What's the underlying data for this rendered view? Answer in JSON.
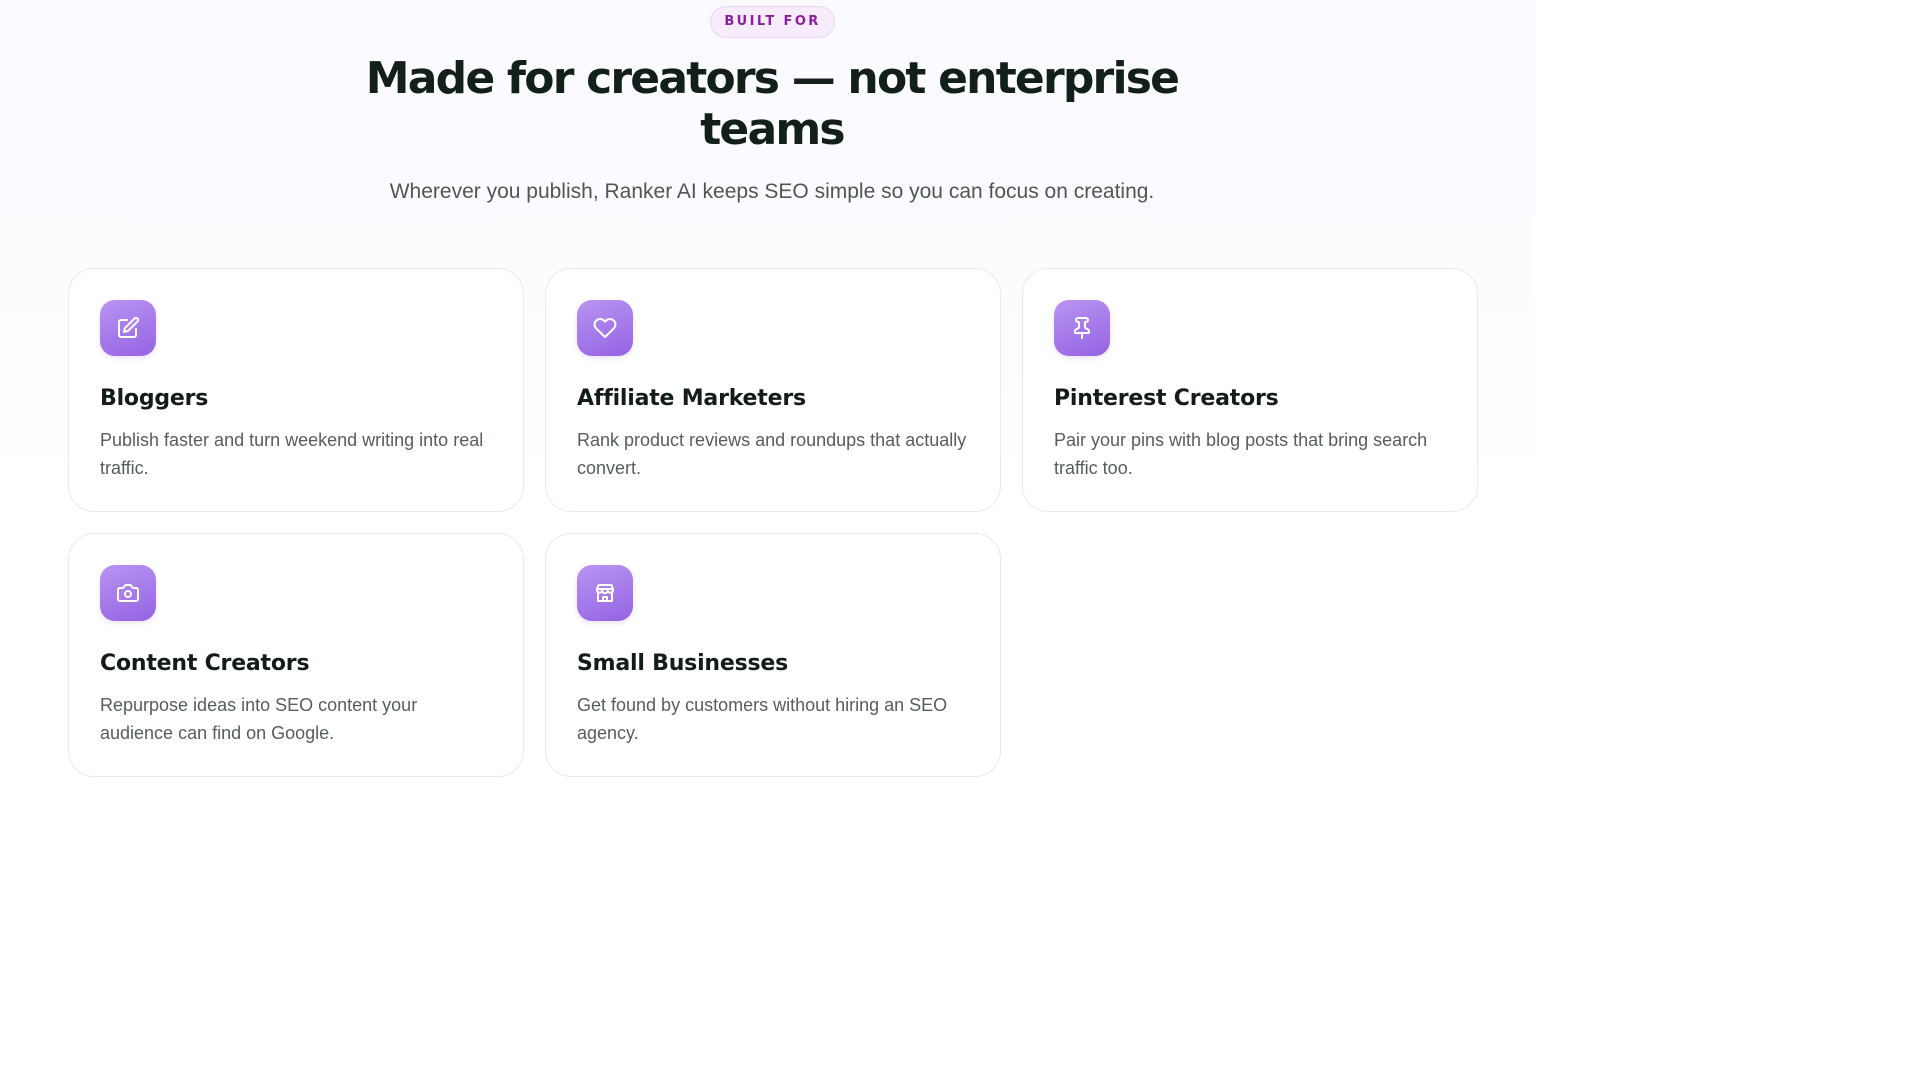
{
  "section": {
    "badge": "BUILT FOR",
    "title": "Made for creators — not enterprise teams",
    "subtitle": "Wherever you publish, Ranker AI keeps SEO simple so you can focus on creating."
  },
  "cards": [
    {
      "icon": "edit-icon",
      "title": "Bloggers",
      "description": "Publish faster and turn weekend writing into real traffic."
    },
    {
      "icon": "heart-icon",
      "title": "Affiliate Marketers",
      "description": "Rank product reviews and roundups that actually convert."
    },
    {
      "icon": "pin-icon",
      "title": "Pinterest Creators",
      "description": "Pair your pins with blog posts that bring search traffic too."
    },
    {
      "icon": "camera-icon",
      "title": "Content Creators",
      "description": "Repurpose ideas into SEO content your audience can find on Google."
    },
    {
      "icon": "store-icon",
      "title": "Small Businesses",
      "description": "Get found by customers without hiring an SEO agency."
    }
  ],
  "colors": {
    "accent": "#9563e3",
    "badge_text": "#8a1f9b",
    "heading": "#13201a"
  }
}
